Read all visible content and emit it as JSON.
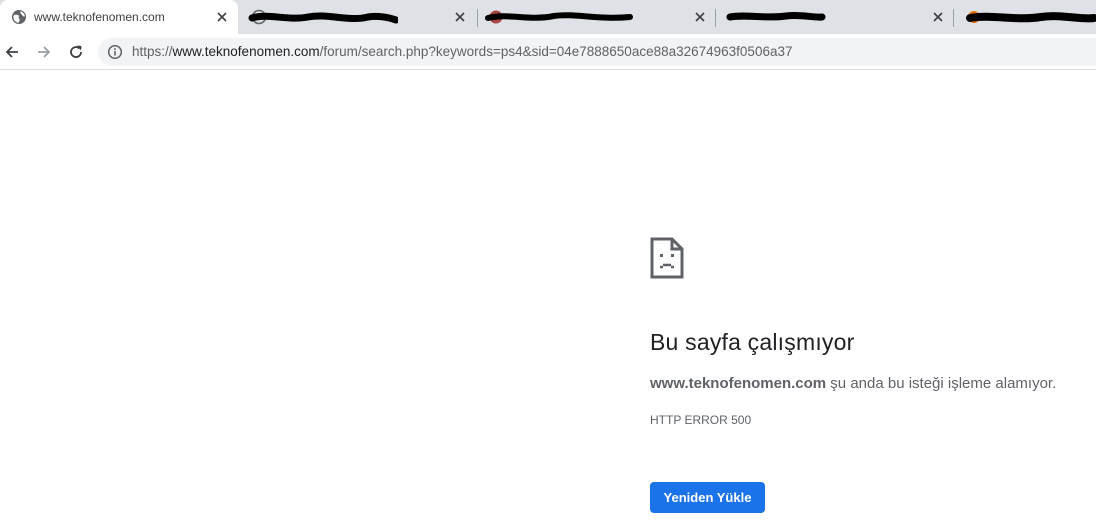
{
  "tabs": [
    {
      "title": "www.teknofenomen.com",
      "active": true,
      "redacted": false
    },
    {
      "title": "",
      "active": false,
      "redacted": true
    },
    {
      "title": "",
      "active": false,
      "redacted": true
    },
    {
      "title": "",
      "active": false,
      "redacted": true
    },
    {
      "title": "",
      "active": false,
      "redacted": true
    }
  ],
  "omnibox": {
    "scheme": "https://",
    "host": "www.teknofenomen.com",
    "path": "/forum/search.php?keywords=ps4&sid=04e7888650ace88a32674963f0506a37"
  },
  "error_page": {
    "icon": "sad-page-icon",
    "title": "Bu sayfa çalışmıyor",
    "message_host": "www.teknofenomen.com",
    "message_rest": " şu anda bu isteği işleme alamıyor.",
    "error_code": "HTTP ERROR 500",
    "reload_label": "Yeniden Yükle"
  },
  "colors": {
    "tabstrip_bg": "#dee1e6",
    "omnibox_bg": "#f1f3f4",
    "primary_button": "#1a73e8",
    "redaction": "#000000"
  }
}
